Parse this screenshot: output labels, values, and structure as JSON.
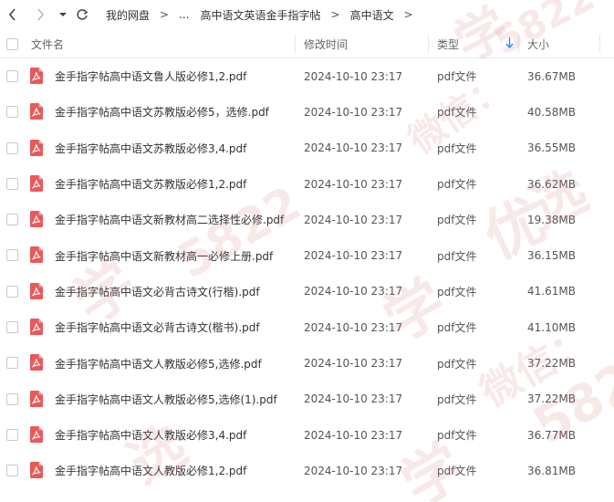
{
  "breadcrumb": {
    "items": [
      "我的网盘",
      "...",
      "高中语文英语金手指字帖",
      "高中语文"
    ],
    "separator": ">"
  },
  "header": {
    "name_label": "文件名",
    "time_label": "修改时间",
    "type_label": "类型",
    "size_label": "大小"
  },
  "files": [
    {
      "name": "金手指字帖高中语文鲁人版必修1,2.pdf",
      "time": "2024-10-10 23:17",
      "type": "pdf文件",
      "size": "36.67MB"
    },
    {
      "name": "金手指字帖高中语文苏教版必修5，选修.pdf",
      "time": "2024-10-10 23:17",
      "type": "pdf文件",
      "size": "40.58MB"
    },
    {
      "name": "金手指字帖高中语文苏教版必修3,4.pdf",
      "time": "2024-10-10 23:17",
      "type": "pdf文件",
      "size": "36.55MB"
    },
    {
      "name": "金手指字帖高中语文苏教版必修1,2.pdf",
      "time": "2024-10-10 23:17",
      "type": "pdf文件",
      "size": "36.62MB"
    },
    {
      "name": "金手指字帖高中语文新教材高二选择性必修.pdf",
      "time": "2024-10-10 23:17",
      "type": "pdf文件",
      "size": "19.38MB"
    },
    {
      "name": "金手指字帖高中语文新教材高一必修上册.pdf",
      "time": "2024-10-10 23:17",
      "type": "pdf文件",
      "size": "36.15MB"
    },
    {
      "name": "金手指字帖高中语文必背古诗文(行楷).pdf",
      "time": "2024-10-10 23:17",
      "type": "pdf文件",
      "size": "41.61MB"
    },
    {
      "name": "金手指字帖高中语文必背古诗文(楷书).pdf",
      "time": "2024-10-10 23:17",
      "type": "pdf文件",
      "size": "41.10MB"
    },
    {
      "name": "金手指字帖高中语文人教版必修5,选修.pdf",
      "time": "2024-10-10 23:17",
      "type": "pdf文件",
      "size": "37.22MB"
    },
    {
      "name": "金手指字帖高中语文人教版必修5,选修(1).pdf",
      "time": "2024-10-10 23:17",
      "type": "pdf文件",
      "size": "37.22MB"
    },
    {
      "name": "金手指字帖高中语文人教版必修3,4.pdf",
      "time": "2024-10-10 23:17",
      "type": "pdf文件",
      "size": "36.77MB"
    },
    {
      "name": "金手指字帖高中语文人教版必修1,2.pdf",
      "time": "2024-10-10 23:17",
      "type": "pdf文件",
      "size": "36.81MB"
    }
  ],
  "icons": {
    "back": "chevron-left-icon",
    "forward": "chevron-right-icon",
    "dropdown": "caret-down-icon",
    "refresh": "refresh-icon",
    "file": "pdf-icon",
    "sort": "sort-down-arrow-icon"
  },
  "colors": {
    "pdf_icon": "#e8595a",
    "sort_arrow": "#2f8ef3",
    "watermark": "#d67878"
  },
  "watermarks": [
    "学",
    "微信：",
    "5822",
    "选",
    "优"
  ]
}
